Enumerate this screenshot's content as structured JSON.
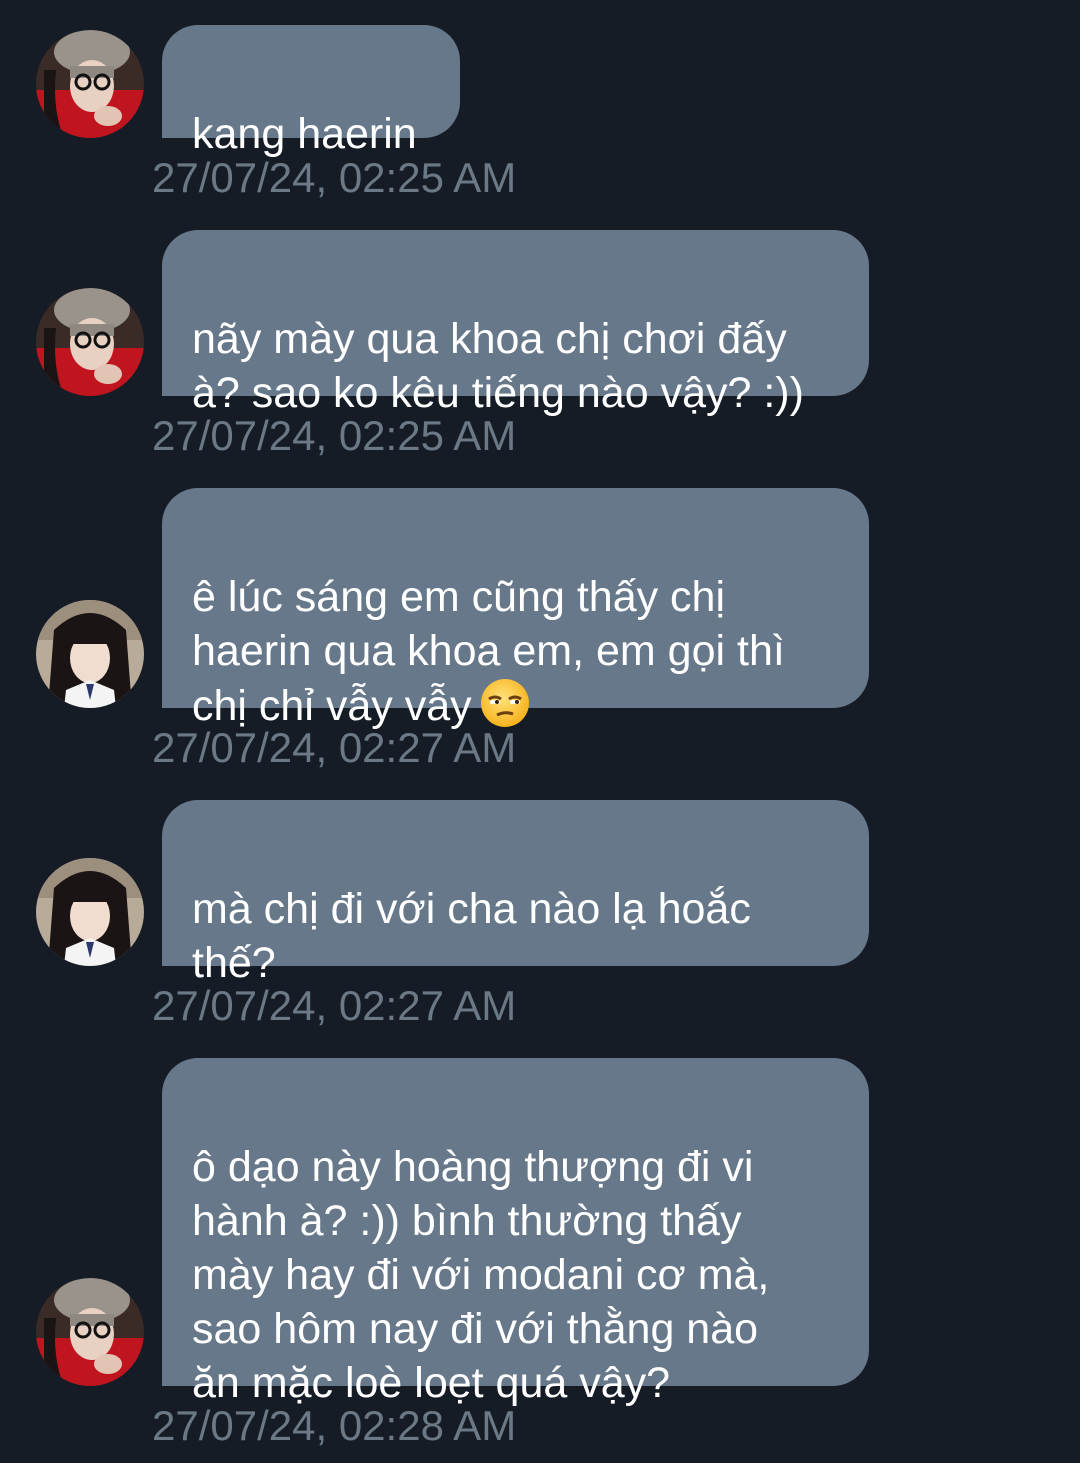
{
  "messages": [
    {
      "sender": "haerin-avatar",
      "text": "kang haerin",
      "time": "27/07/24, 02:25 AM"
    },
    {
      "sender": "haerin-avatar",
      "text": "nãy mày qua khoa chị chơi đấy\nà? sao ko kêu tiếng nào vậy? :))",
      "time": "27/07/24, 02:25 AM"
    },
    {
      "sender": "hanni-avatar",
      "text": "ê lúc sáng em cũng thấy chị\nhaerin qua khoa em, em gọi thì\nchị chỉ vẫy vẫy",
      "emoji": "unamused-face-icon",
      "time": "27/07/24, 02:27 AM"
    },
    {
      "sender": "hanni-avatar",
      "text": "mà chị đi với cha nào lạ hoắc\nthế?",
      "time": "27/07/24, 02:27 AM"
    },
    {
      "sender": "haerin-avatar",
      "text": "ô dạo này hoàng thượng đi vi\nhành à? :)) bình thường thấy\nmày hay đi với modani cơ mà,\nsao hôm nay đi với thằng nào\năn mặc loè loẹt quá vậy?",
      "time": "27/07/24, 02:28 AM"
    }
  ],
  "colors": {
    "background": "#151c26",
    "bubble": "#66788a",
    "timestamp": "#6b7886",
    "text": "#ffffff"
  }
}
